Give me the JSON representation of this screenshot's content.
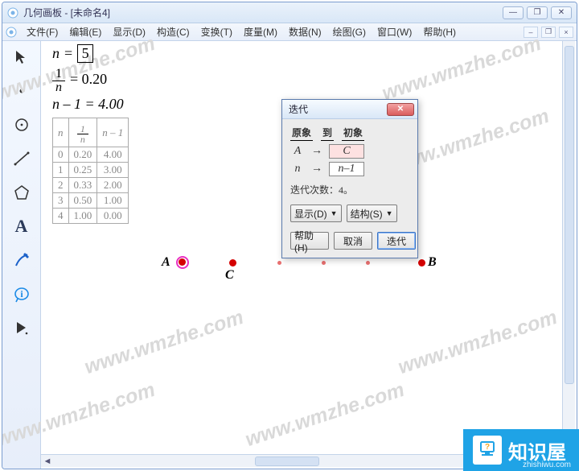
{
  "title": "几何画板 - [未命名4]",
  "menus": [
    "文件(F)",
    "编辑(E)",
    "显示(D)",
    "构造(C)",
    "变换(T)",
    "度量(M)",
    "数据(N)",
    "绘图(G)",
    "窗口(W)",
    "帮助(H)"
  ],
  "doc_right_labels": {
    "min": "–",
    "max": "❐",
    "close": "×"
  },
  "tools": [
    "arrow",
    "point",
    "circle",
    "line",
    "polygon",
    "text",
    "pen",
    "info",
    "script"
  ],
  "math": {
    "nVar": "n",
    "nEq": "=",
    "nVal": "5",
    "fracNum": "1",
    "fracDen": "n",
    "fracEq": "= 0.20",
    "expr2": "n – 1 = 4.00"
  },
  "table": {
    "h1": "n",
    "h2num": "1",
    "h2den": "n",
    "h3": "n – 1",
    "rows": [
      [
        "0",
        "0.20",
        "4.00"
      ],
      [
        "1",
        "0.25",
        "3.00"
      ],
      [
        "2",
        "0.33",
        "2.00"
      ],
      [
        "3",
        "0.50",
        "1.00"
      ],
      [
        "4",
        "1.00",
        "0.00"
      ]
    ]
  },
  "points": {
    "A": "A",
    "B": "B",
    "C": "C"
  },
  "dialog": {
    "title": "迭代",
    "head1": "原象",
    "head2": "到",
    "head3": "初象",
    "rows": [
      {
        "src": "A",
        "dst": "C",
        "pink": true
      },
      {
        "src": "n",
        "dst": "n–1",
        "pink": false
      }
    ],
    "depthLabel": "迭代次数：",
    "depthVal": "4。",
    "btnDisplay": "显示(D)",
    "btnStruct": "结构(S)",
    "btnHelp": "帮助(H)",
    "btnCancel": "取消",
    "btnIterate": "迭代"
  },
  "watermark_text": "www.wmzhe.com",
  "branding": {
    "text": "知识屋",
    "sub": "zhishiwu.com"
  }
}
